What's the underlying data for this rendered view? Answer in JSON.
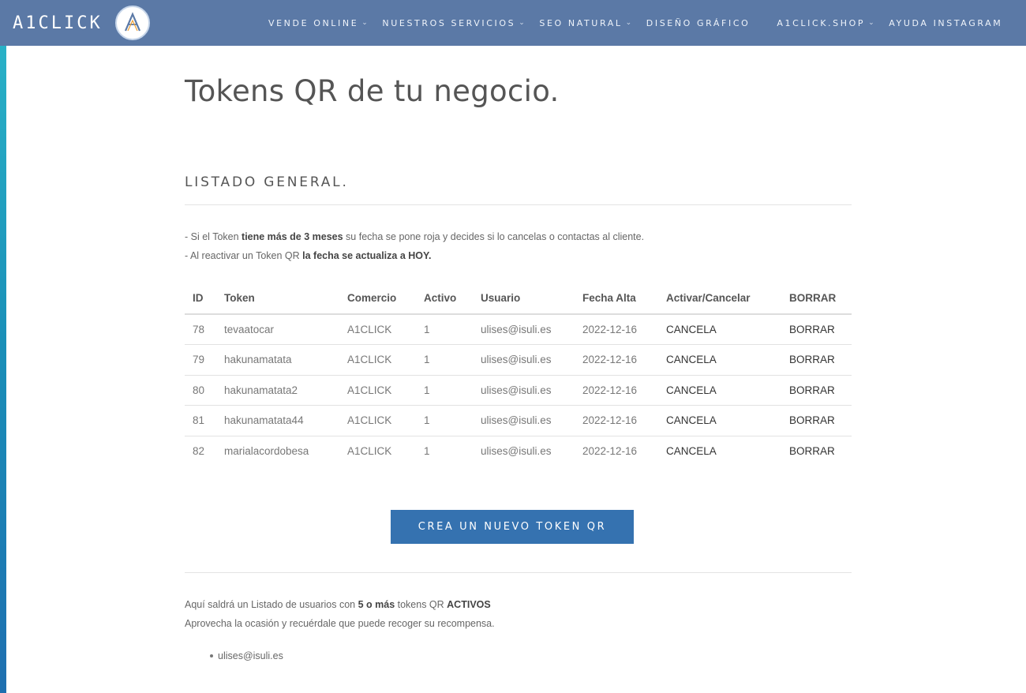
{
  "header": {
    "brand": "A1CLICK",
    "nav": [
      {
        "label": "VENDE ONLINE",
        "chevron": true
      },
      {
        "label": "NUESTROS SERVICIOS",
        "chevron": true
      },
      {
        "label": "SEO NATURAL",
        "chevron": true
      },
      {
        "label": "DISEÑO GRÁFICO",
        "chevron": false
      },
      {
        "label": "A1CLICK.SHOP",
        "chevron": true
      },
      {
        "label": "AYUDA INSTAGRAM",
        "chevron": false
      }
    ]
  },
  "page": {
    "title": "Tokens QR de tu negocio.",
    "section_title": "LISTADO GENERAL.",
    "note1_pre": "- Si el Token ",
    "note1_bold": "tiene más de 3 meses",
    "note1_post": " su fecha se pone roja y decides si lo cancelas o contactas al cliente.",
    "note2_pre": "- Al reactivar un Token QR ",
    "note2_bold": "la fecha se actualiza a HOY."
  },
  "table": {
    "headers": [
      "ID",
      "Token",
      "Comercio",
      "Activo",
      "Usuario",
      "Fecha Alta",
      "Activar/Cancelar",
      "BORRAR"
    ],
    "rows": [
      [
        "78",
        "tevaatocar",
        "A1CLICK",
        "1",
        "ulises@isuli.es",
        "2022-12-16",
        "CANCELA",
        "BORRAR"
      ],
      [
        "79",
        "hakunamatata",
        "A1CLICK",
        "1",
        "ulises@isuli.es",
        "2022-12-16",
        "CANCELA",
        "BORRAR"
      ],
      [
        "80",
        "hakunamatata2",
        "A1CLICK",
        "1",
        "ulises@isuli.es",
        "2022-12-16",
        "CANCELA",
        "BORRAR"
      ],
      [
        "81",
        "hakunamatata44",
        "A1CLICK",
        "1",
        "ulises@isuli.es",
        "2022-12-16",
        "CANCELA",
        "BORRAR"
      ],
      [
        "82",
        "marialacordobesa",
        "A1CLICK",
        "1",
        "ulises@isuli.es",
        "2022-12-16",
        "CANCELA",
        "BORRAR"
      ]
    ]
  },
  "cta": {
    "label": "CREA UN NUEVO TOKEN QR"
  },
  "info": {
    "line1_pre": "Aquí saldrá un Listado de usuarios con ",
    "line1_bold1": "5 o más",
    "line1_mid": " tokens QR ",
    "line1_bold2": "ACTIVOS",
    "line2": "Aprovecha la ocasión y recuérdale que puede recoger su recompensa.",
    "users": [
      "ulises@isuli.es"
    ]
  }
}
